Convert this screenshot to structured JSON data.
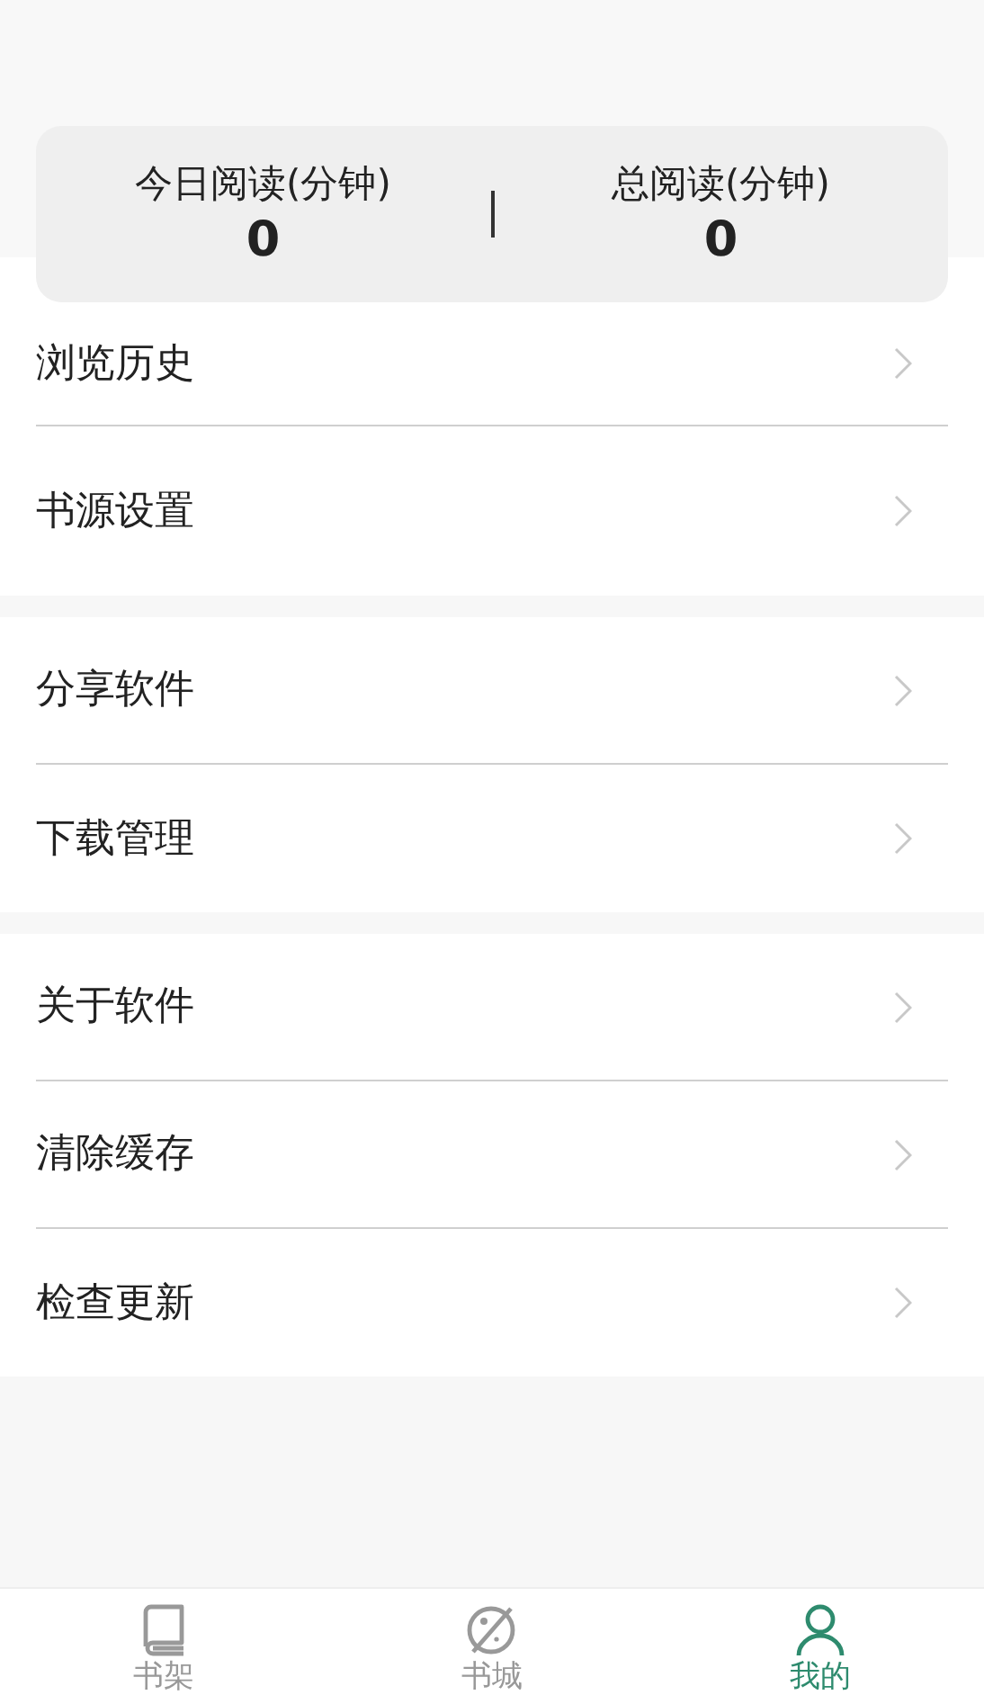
{
  "stats": [
    {
      "label": "今日阅读(分钟)",
      "value": "0"
    },
    {
      "label": "总阅读(分钟)",
      "value": "0"
    }
  ],
  "menu_groups": [
    {
      "items": [
        {
          "label": "浏览历史"
        },
        {
          "label": "书源设置"
        }
      ]
    },
    {
      "items": [
        {
          "label": "分享软件"
        },
        {
          "label": "下载管理"
        }
      ]
    },
    {
      "items": [
        {
          "label": "关于软件"
        },
        {
          "label": "清除缓存"
        },
        {
          "label": "检查更新"
        }
      ]
    }
  ],
  "tabs": [
    {
      "label": "书架",
      "kind": "shelf",
      "selected": false
    },
    {
      "label": "书城",
      "kind": "store",
      "selected": false
    },
    {
      "label": "我的",
      "kind": "profile",
      "selected": true
    }
  ]
}
